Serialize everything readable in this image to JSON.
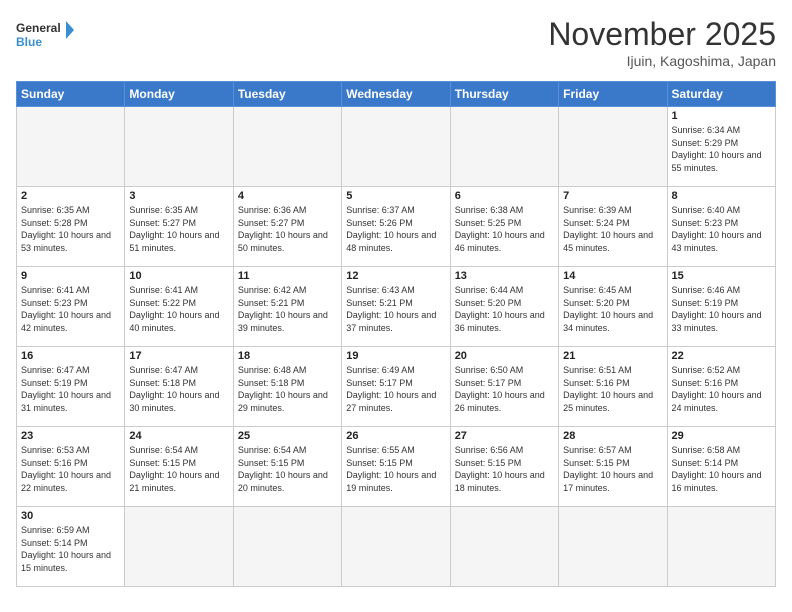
{
  "header": {
    "title": "November 2025",
    "subtitle": "Ijuin, Kagoshima, Japan",
    "logo_general": "General",
    "logo_blue": "Blue"
  },
  "weekdays": [
    "Sunday",
    "Monday",
    "Tuesday",
    "Wednesday",
    "Thursday",
    "Friday",
    "Saturday"
  ],
  "weeks": [
    [
      {
        "day": "",
        "empty": true
      },
      {
        "day": "",
        "empty": true
      },
      {
        "day": "",
        "empty": true
      },
      {
        "day": "",
        "empty": true
      },
      {
        "day": "",
        "empty": true
      },
      {
        "day": "",
        "empty": true
      },
      {
        "day": "1",
        "sunrise": "6:34 AM",
        "sunset": "5:29 PM",
        "daylight": "10 hours and 55 minutes."
      }
    ],
    [
      {
        "day": "2",
        "sunrise": "6:35 AM",
        "sunset": "5:28 PM",
        "daylight": "10 hours and 53 minutes."
      },
      {
        "day": "3",
        "sunrise": "6:35 AM",
        "sunset": "5:27 PM",
        "daylight": "10 hours and 51 minutes."
      },
      {
        "day": "4",
        "sunrise": "6:36 AM",
        "sunset": "5:27 PM",
        "daylight": "10 hours and 50 minutes."
      },
      {
        "day": "5",
        "sunrise": "6:37 AM",
        "sunset": "5:26 PM",
        "daylight": "10 hours and 48 minutes."
      },
      {
        "day": "6",
        "sunrise": "6:38 AM",
        "sunset": "5:25 PM",
        "daylight": "10 hours and 46 minutes."
      },
      {
        "day": "7",
        "sunrise": "6:39 AM",
        "sunset": "5:24 PM",
        "daylight": "10 hours and 45 minutes."
      },
      {
        "day": "8",
        "sunrise": "6:40 AM",
        "sunset": "5:23 PM",
        "daylight": "10 hours and 43 minutes."
      }
    ],
    [
      {
        "day": "9",
        "sunrise": "6:41 AM",
        "sunset": "5:23 PM",
        "daylight": "10 hours and 42 minutes."
      },
      {
        "day": "10",
        "sunrise": "6:41 AM",
        "sunset": "5:22 PM",
        "daylight": "10 hours and 40 minutes."
      },
      {
        "day": "11",
        "sunrise": "6:42 AM",
        "sunset": "5:21 PM",
        "daylight": "10 hours and 39 minutes."
      },
      {
        "day": "12",
        "sunrise": "6:43 AM",
        "sunset": "5:21 PM",
        "daylight": "10 hours and 37 minutes."
      },
      {
        "day": "13",
        "sunrise": "6:44 AM",
        "sunset": "5:20 PM",
        "daylight": "10 hours and 36 minutes."
      },
      {
        "day": "14",
        "sunrise": "6:45 AM",
        "sunset": "5:20 PM",
        "daylight": "10 hours and 34 minutes."
      },
      {
        "day": "15",
        "sunrise": "6:46 AM",
        "sunset": "5:19 PM",
        "daylight": "10 hours and 33 minutes."
      }
    ],
    [
      {
        "day": "16",
        "sunrise": "6:47 AM",
        "sunset": "5:19 PM",
        "daylight": "10 hours and 31 minutes."
      },
      {
        "day": "17",
        "sunrise": "6:47 AM",
        "sunset": "5:18 PM",
        "daylight": "10 hours and 30 minutes."
      },
      {
        "day": "18",
        "sunrise": "6:48 AM",
        "sunset": "5:18 PM",
        "daylight": "10 hours and 29 minutes."
      },
      {
        "day": "19",
        "sunrise": "6:49 AM",
        "sunset": "5:17 PM",
        "daylight": "10 hours and 27 minutes."
      },
      {
        "day": "20",
        "sunrise": "6:50 AM",
        "sunset": "5:17 PM",
        "daylight": "10 hours and 26 minutes."
      },
      {
        "day": "21",
        "sunrise": "6:51 AM",
        "sunset": "5:16 PM",
        "daylight": "10 hours and 25 minutes."
      },
      {
        "day": "22",
        "sunrise": "6:52 AM",
        "sunset": "5:16 PM",
        "daylight": "10 hours and 24 minutes."
      }
    ],
    [
      {
        "day": "23",
        "sunrise": "6:53 AM",
        "sunset": "5:16 PM",
        "daylight": "10 hours and 22 minutes."
      },
      {
        "day": "24",
        "sunrise": "6:54 AM",
        "sunset": "5:15 PM",
        "daylight": "10 hours and 21 minutes."
      },
      {
        "day": "25",
        "sunrise": "6:54 AM",
        "sunset": "5:15 PM",
        "daylight": "10 hours and 20 minutes."
      },
      {
        "day": "26",
        "sunrise": "6:55 AM",
        "sunset": "5:15 PM",
        "daylight": "10 hours and 19 minutes."
      },
      {
        "day": "27",
        "sunrise": "6:56 AM",
        "sunset": "5:15 PM",
        "daylight": "10 hours and 18 minutes."
      },
      {
        "day": "28",
        "sunrise": "6:57 AM",
        "sunset": "5:15 PM",
        "daylight": "10 hours and 17 minutes."
      },
      {
        "day": "29",
        "sunrise": "6:58 AM",
        "sunset": "5:14 PM",
        "daylight": "10 hours and 16 minutes."
      }
    ],
    [
      {
        "day": "30",
        "sunrise": "6:59 AM",
        "sunset": "5:14 PM",
        "daylight": "10 hours and 15 minutes."
      },
      {
        "day": "",
        "empty": true
      },
      {
        "day": "",
        "empty": true
      },
      {
        "day": "",
        "empty": true
      },
      {
        "day": "",
        "empty": true
      },
      {
        "day": "",
        "empty": true
      },
      {
        "day": "",
        "empty": true
      }
    ]
  ]
}
